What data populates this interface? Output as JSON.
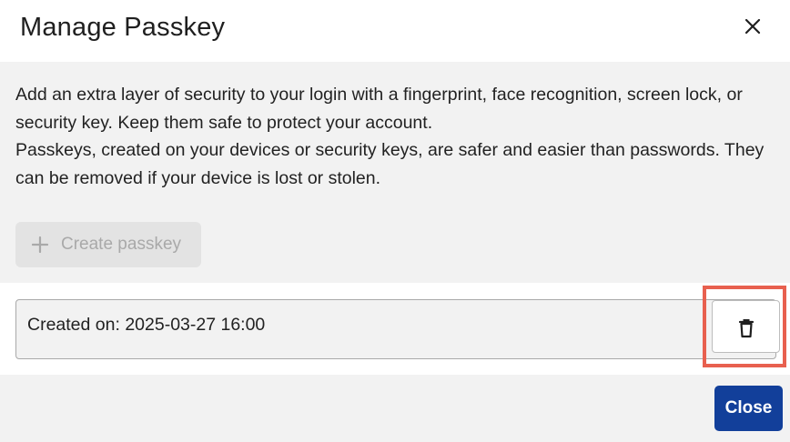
{
  "dialog": {
    "title": "Manage Passkey",
    "close_icon": "close-icon"
  },
  "description": {
    "line1": "Add an extra layer of security to your login with a fingerprint, face recognition, screen lock, or security key. Keep them safe to protect your account.",
    "line2": "Passkeys, created on your devices or security keys, are safer and easier than passwords. They can be removed if your device is lost or stolen."
  },
  "create_button": {
    "icon": "plus-icon",
    "label": "Create passkey",
    "disabled": true
  },
  "passkeys": [
    {
      "created_text": "Created on: 2025-03-27 16:00",
      "delete_icon": "trash-icon"
    }
  ],
  "footer": {
    "close_label": "Close"
  },
  "colors": {
    "primary": "#123f9a",
    "highlight": "#e8604f",
    "disabled_text": "#a9a9a9"
  }
}
